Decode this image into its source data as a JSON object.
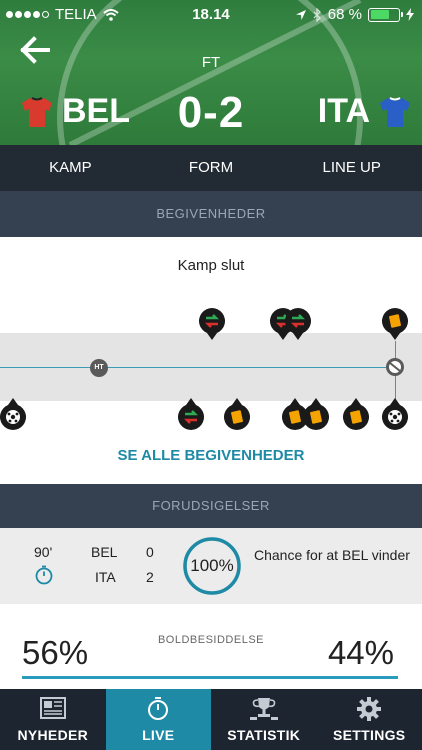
{
  "status_bar": {
    "carrier": "TELIA",
    "time": "18.14",
    "battery": "68 %"
  },
  "match": {
    "status": "FT",
    "home": {
      "code": "BEL",
      "shirt_color": "#d93a2e"
    },
    "away": {
      "code": "ITA",
      "shirt_color": "#2a5fc7"
    },
    "score": "0-2"
  },
  "tabs": [
    "KAMP",
    "FORM",
    "LINE UP"
  ],
  "events": {
    "header": "BEGIVENHEDER",
    "match_end_label": "Kamp slut",
    "halftime_label": "HT",
    "see_all": "SE ALLE BEGIVENHEDER",
    "home_icons": [
      "substitution-icon",
      "substitution-icon",
      "substitution-icon",
      "yellow-card-icon"
    ],
    "away_icons": [
      "goal-icon",
      "substitution-icon",
      "yellow-card-icon",
      "yellow-card-icon",
      "yellow-card-icon",
      "yellow-card-icon",
      "goal-icon"
    ]
  },
  "prediction": {
    "header": "FORUDSIGELSER",
    "minute": "90'",
    "rows": [
      {
        "team": "BEL",
        "score": "0"
      },
      {
        "team": "ITA",
        "score": "2"
      }
    ],
    "chance": "100%",
    "chance_fraction": 1.0,
    "description": "Chance for at BEL vinder"
  },
  "possession": {
    "label": "BOLDBESIDDELSE",
    "home": "56%",
    "away": "44%"
  },
  "bottom_nav": [
    {
      "label": "NYHEDER",
      "icon": "news-icon",
      "active": false
    },
    {
      "label": "LIVE",
      "icon": "stopwatch-icon",
      "active": true
    },
    {
      "label": "STATISTIK",
      "icon": "trophy-icon",
      "active": false
    },
    {
      "label": "SETTINGS",
      "icon": "gear-icon",
      "active": false
    }
  ],
  "colors": {
    "accent": "#1e8aa5",
    "pitch": "#3b8c47",
    "dark": "#222a33",
    "yellow_card": "#f5a300",
    "sub_in": "#2faa54",
    "sub_out": "#d8302c"
  }
}
